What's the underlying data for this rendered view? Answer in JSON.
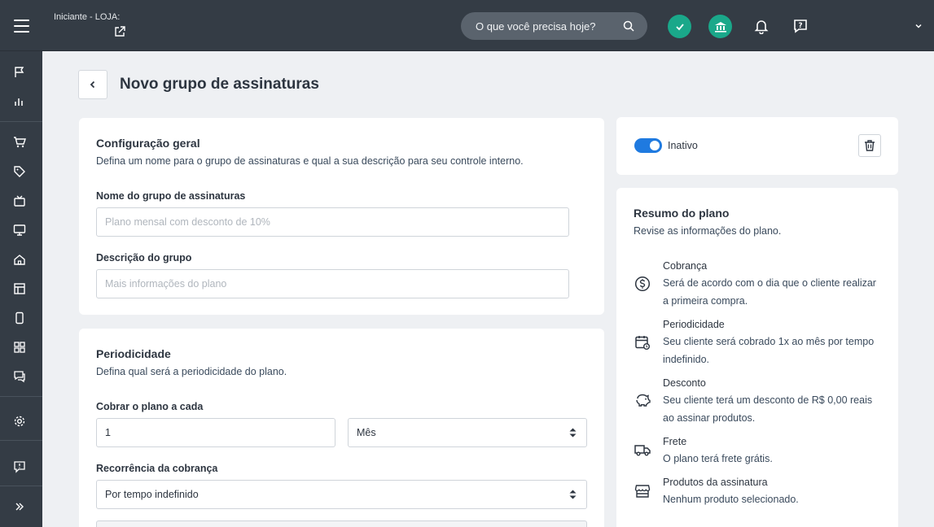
{
  "topbar": {
    "store_label": "Iniciante - LOJA:",
    "search_placeholder": "O que você precisa hoje?",
    "accent_green": "#1aa88a"
  },
  "sidebar": {
    "icons": [
      "flag-icon",
      "chart-icon",
      "cart-icon",
      "tag-icon",
      "tv-icon",
      "monitor-icon",
      "home-icon",
      "layout-icon",
      "phone-icon",
      "apps-icon",
      "chat-icon",
      "gear-icon",
      "feedback-icon",
      "expand-icon"
    ]
  },
  "page": {
    "title": "Novo grupo de assinaturas"
  },
  "general": {
    "title": "Configuração geral",
    "subtitle": "Defina um nome para o grupo de assinaturas e qual a sua descrição para seu controle interno.",
    "name_label": "Nome do grupo de assinaturas",
    "name_placeholder": "Plano mensal com desconto de 10%",
    "desc_label": "Descrição do grupo",
    "desc_placeholder": "Mais informações do plano"
  },
  "periodicity": {
    "title": "Periodicidade",
    "subtitle": "Defina qual será a periodicidade do plano.",
    "charge_label": "Cobrar o plano a cada",
    "charge_value": "1",
    "unit_value": "Mês",
    "recurrence_label": "Recorrência da cobrança",
    "recurrence_value": "Por tempo indefinido"
  },
  "status": {
    "label": "Inativo",
    "toggle_color": "#1f7ae0"
  },
  "summary": {
    "title": "Resumo do plano",
    "subtitle": "Revise as informações do plano.",
    "items": [
      {
        "title": "Cobrança",
        "desc": "Será de acordo com o dia que o cliente realizar a primeira compra.",
        "icon": "dollar-icon"
      },
      {
        "title": "Periodicidade",
        "desc": "Seu cliente será cobrado 1x ao mês por tempo indefinido.",
        "icon": "calendar-icon"
      },
      {
        "title": "Desconto",
        "desc": "Seu cliente terá um desconto de R$ 0,00 reais ao assinar produtos.",
        "icon": "piggy-bank-icon"
      },
      {
        "title": "Frete",
        "desc": "O plano terá frete grátis.",
        "icon": "truck-icon"
      },
      {
        "title": "Produtos da assinatura",
        "desc": "Nenhum produto selecionado.",
        "icon": "store-icon"
      }
    ]
  }
}
